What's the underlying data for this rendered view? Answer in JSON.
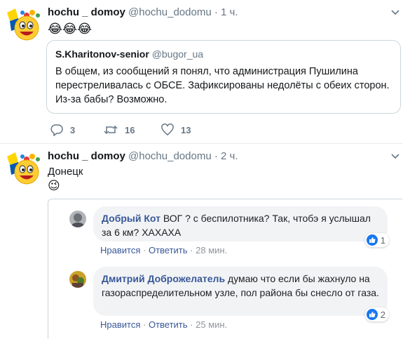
{
  "tweet1": {
    "name": "hochu _ domoy",
    "handle": "@hochu_dodomu",
    "separator": "·",
    "time": "1 ч.",
    "emojis": "😂😂😂",
    "quote": {
      "name": "S.Kharitonov-senior",
      "handle": "@bugor_ua",
      "text": "В общем, из сообщений я понял, что администрация Пушилина перестреливалась с ОБСЕ. Зафиксированы недолёты с обеих сторон. Из-за бабы? Возможно."
    },
    "replies": "3",
    "retweets": "16",
    "likes": "13"
  },
  "tweet2": {
    "name": "hochu _ domoy",
    "handle": "@hochu_dodomu",
    "separator": "·",
    "time": "2 ч.",
    "text": "Донецк",
    "emoji": "😉",
    "comments": [
      {
        "author": "Добрый Кот",
        "text": "ВОГ ? с беспилотника? Так, чтобэ я услышал за 6 км? ХАХАХА",
        "like": "Нравится",
        "sep": "·",
        "reply": "Ответить",
        "time": "28 мин.",
        "reactions": "1"
      },
      {
        "author": "Дмитрий Доброжелатель",
        "text": "думаю что если бы жахнуло на газораспределительном узле, пол района бы снесло от газа.",
        "like": "Нравится",
        "sep": "·",
        "reply": "Ответить",
        "time": "25 мин.",
        "reactions": "2"
      }
    ]
  },
  "colors": {
    "link": "#385898",
    "muted": "#657786",
    "border": "#ccd6dd",
    "like": "#1877f2"
  }
}
